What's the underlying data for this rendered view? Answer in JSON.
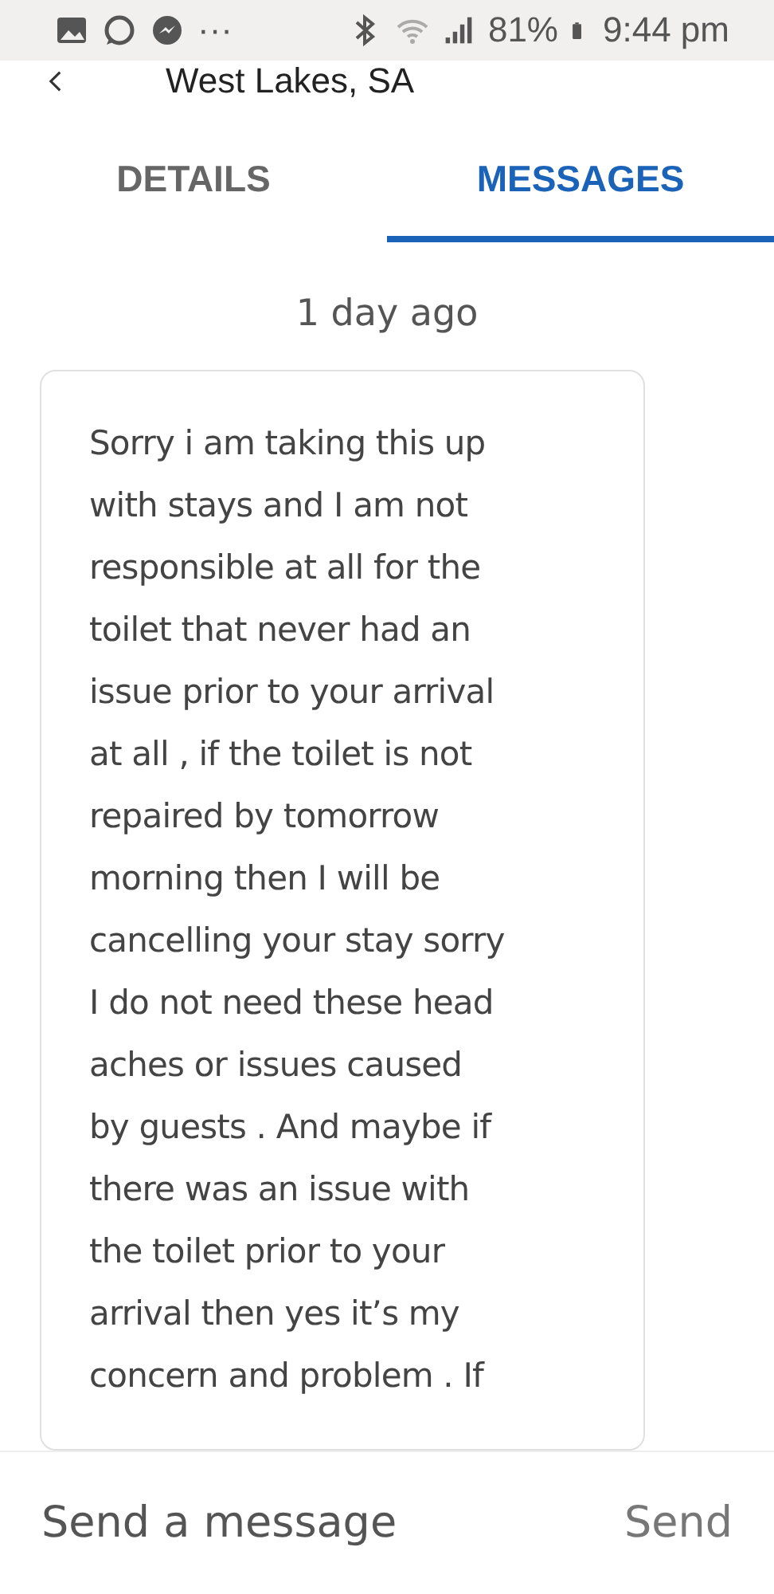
{
  "status_bar": {
    "more": "···",
    "battery": "81%",
    "time": "9:44 pm"
  },
  "header": {
    "title": "West Lakes, SA"
  },
  "tabs": [
    {
      "label": "DETAILS",
      "selected": false
    },
    {
      "label": "MESSAGES",
      "selected": true
    }
  ],
  "messages": [
    {
      "time": "1 day ago",
      "lines": [
        "Sorry i am taking this up",
        "with stays and I am not",
        "responsible at all for the",
        "toilet that never had an",
        "issue prior to your arrival",
        "at all , if the toilet is not",
        "repaired by tomorrow",
        "morning then I will be",
        "cancelling your stay sorry",
        "I do not need these head",
        "aches or issues caused",
        "by guests . And maybe if",
        "there was an issue with",
        "the toilet prior to your",
        "arrival then yes it’s my",
        "concern and problem . If"
      ]
    }
  ],
  "composer": {
    "placeholder": "Send a message",
    "send": "Send"
  }
}
